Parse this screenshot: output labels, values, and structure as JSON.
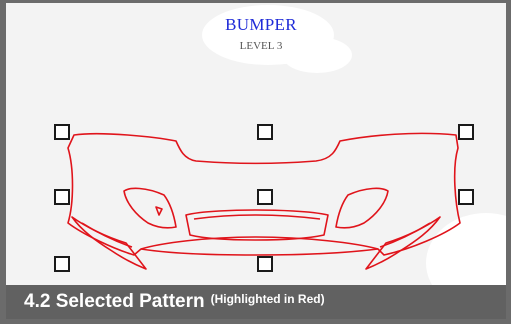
{
  "diagram": {
    "title": "BUMPER",
    "subtitle": "LEVEL 3",
    "pattern_color": "#e0141b",
    "title_color": "#1f2bd8"
  },
  "caption": {
    "main": "4.2 Selected Pattern",
    "note": "(Highlighted in Red)"
  },
  "selection": {
    "handle_count": 8
  }
}
